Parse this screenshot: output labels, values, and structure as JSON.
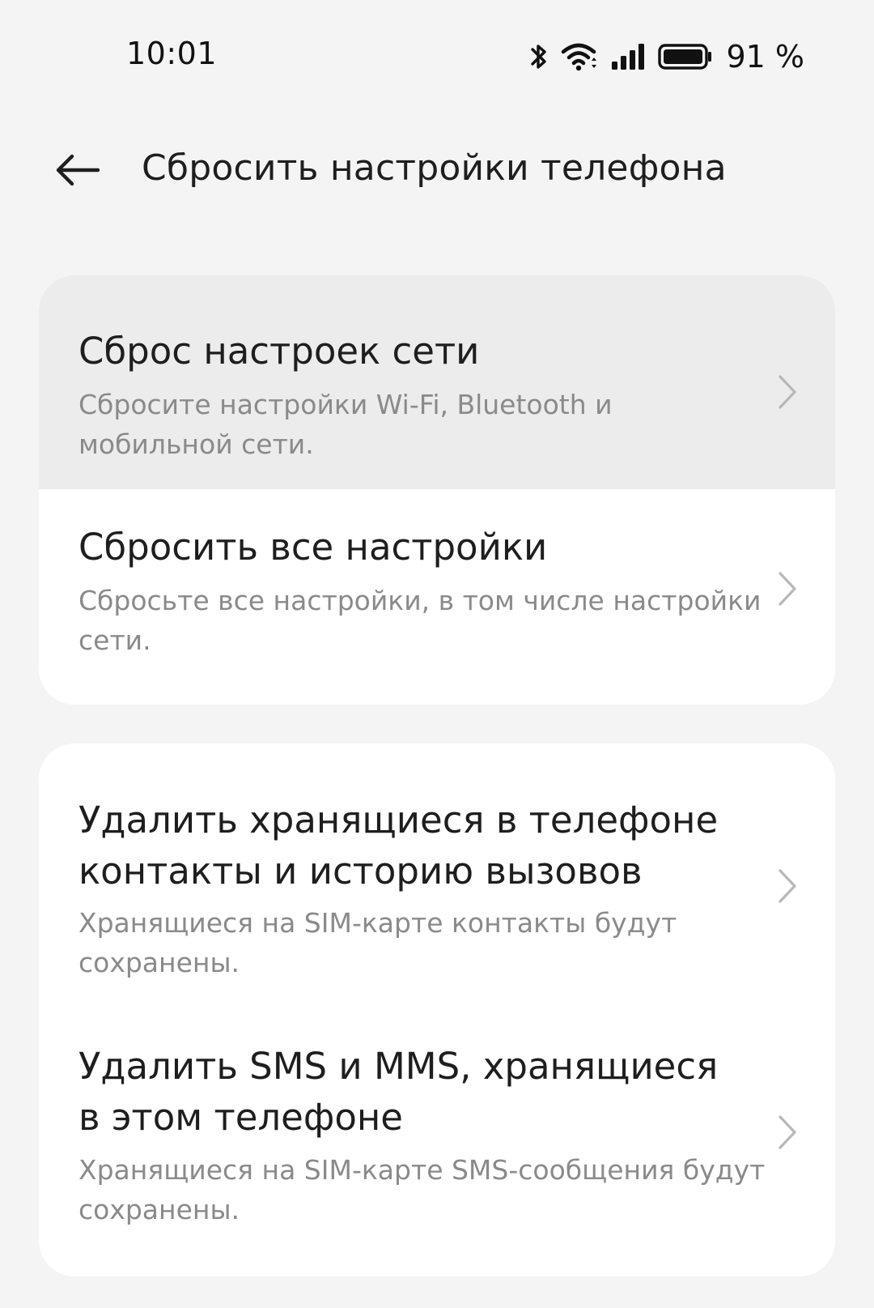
{
  "status_bar": {
    "time": "10:01",
    "battery_percent": "91 %",
    "icons": [
      "bluetooth-icon",
      "wifi-icon",
      "signal-icon",
      "battery-icon"
    ]
  },
  "header": {
    "title": "Сбросить настройки телефона",
    "back_icon": "arrow-left-icon"
  },
  "groups": [
    {
      "items": [
        {
          "title": "Сброс настроек сети",
          "description_lines": [
            "Сбросите настройки Wi-Fi, Bluetooth и",
            "мобильной сети."
          ]
        },
        {
          "title": "Сбросить все настройки",
          "description_lines": [
            "Сбросьте все настройки, в том числе настройки",
            "сети."
          ]
        }
      ]
    },
    {
      "items": [
        {
          "title_lines": [
            "Удалить хранящиеся в телефоне",
            "контакты и историю вызовов"
          ],
          "description_lines": [
            "Хранящиеся на SIM-карте контакты будут",
            "сохранены."
          ]
        },
        {
          "title_lines": [
            "Удалить SMS и MMS, хранящиеся",
            "в этом телефоне"
          ],
          "description_lines": [
            "Хранящиеся на SIM-карте SMS-сообщения будут",
            "сохранены."
          ]
        }
      ]
    }
  ],
  "colors": {
    "background": "#f4f4f4",
    "card": "#ffffff",
    "pressed_row": "#ececec",
    "title_text": "#1e1e1e",
    "secondary_text": "#8a8a8a",
    "chevron": "#b8b8b8"
  }
}
